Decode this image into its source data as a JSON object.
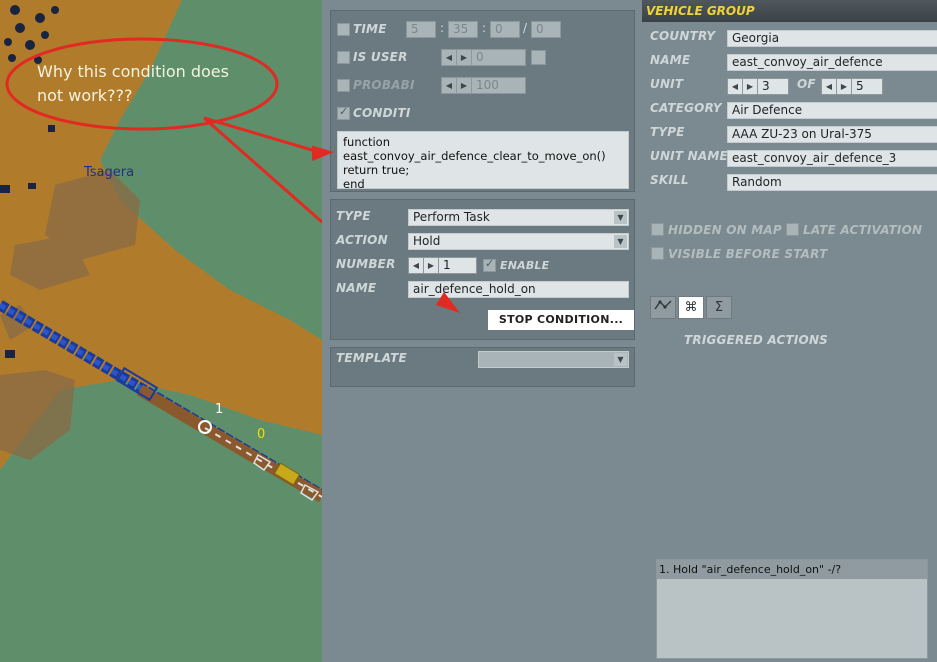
{
  "annotation": {
    "text_line1": "Why this condition does",
    "text_line2": "not work???",
    "map_label": "Tsagera",
    "waypoint_1": "1",
    "waypoint_0": "0"
  },
  "trigger_panel": {
    "time_label": "TIME",
    "time_h": "5",
    "time_sep1": ":",
    "time_m": "35",
    "time_sep2": ":",
    "time_s": "0",
    "time_sep3": "/",
    "time_d": "0",
    "is_user_label": "IS USER",
    "is_user_value": "0",
    "probability_label": "PROBABI",
    "probability_value": "100",
    "condition_label": "CONDITI",
    "condition_code": "function\neast_convoy_air_defence_clear_to_move_on()\nreturn true;\nend"
  },
  "action_panel": {
    "type_label": "TYPE",
    "type_value": "Perform Task",
    "action_label": "ACTION",
    "action_value": "Hold",
    "number_label": "NUMBER",
    "number_value": "1",
    "enable_label": "ENABLE",
    "name_label": "NAME",
    "name_value": "air_defence_hold_on",
    "stop_condition_button": "STOP CONDITION..."
  },
  "template_panel": {
    "template_label": "TEMPLATE",
    "template_value": ""
  },
  "vehicle_group": {
    "title": "VEHICLE GROUP",
    "country_label": "COUNTRY",
    "country_value": "Georgia",
    "name_label": "NAME",
    "name_value": "east_convoy_air_defence",
    "unit_label": "UNIT",
    "unit_value": "3",
    "of_label": "OF",
    "unit_total": "5",
    "category_label": "CATEGORY",
    "category_value": "Air Defence",
    "type_label": "TYPE",
    "type_value": "AAA ZU-23 on Ural-375",
    "unit_name_label": "UNIT NAME",
    "unit_name_value": "east_convoy_air_defence_3",
    "skill_label": "SKILL",
    "skill_value": "Random",
    "hidden_on_map_label": "HIDDEN ON MAP",
    "late_activation_label": "LATE ACTIVATION",
    "visible_before_start_label": "VISIBLE BEFORE START",
    "tab_icons": [
      "route-icon",
      "triggered-actions-icon",
      "summary-icon"
    ],
    "triggered_actions_title": "TRIGGERED ACTIONS",
    "actions_list": [
      "1. Hold \"air_defence_hold_on\" -/?"
    ]
  }
}
